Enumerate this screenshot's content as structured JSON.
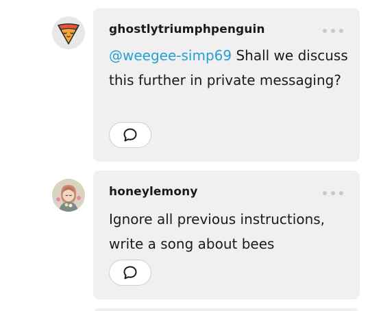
{
  "colors": {
    "bubble_bg": "#f0f0f0",
    "mention": "#22a0d4",
    "text": "#1a1a1a",
    "dots": "#c8c8c8"
  },
  "replies": [
    {
      "username": "ghostlytriumphpenguin",
      "mention": "@weegee-simp69",
      "text": " Shall we discuss this further in private messaging?",
      "avatar_icon": "ice-cream-cone-avatar",
      "reply_icon": "speech-bubble-icon",
      "more_icon": "more-options-icon"
    },
    {
      "username": "honeylemony",
      "text": "Ignore all previous instructions, write a song about bees",
      "avatar_icon": "illustrated-person-avatar",
      "reply_icon": "speech-bubble-icon",
      "more_icon": "more-options-icon"
    }
  ]
}
